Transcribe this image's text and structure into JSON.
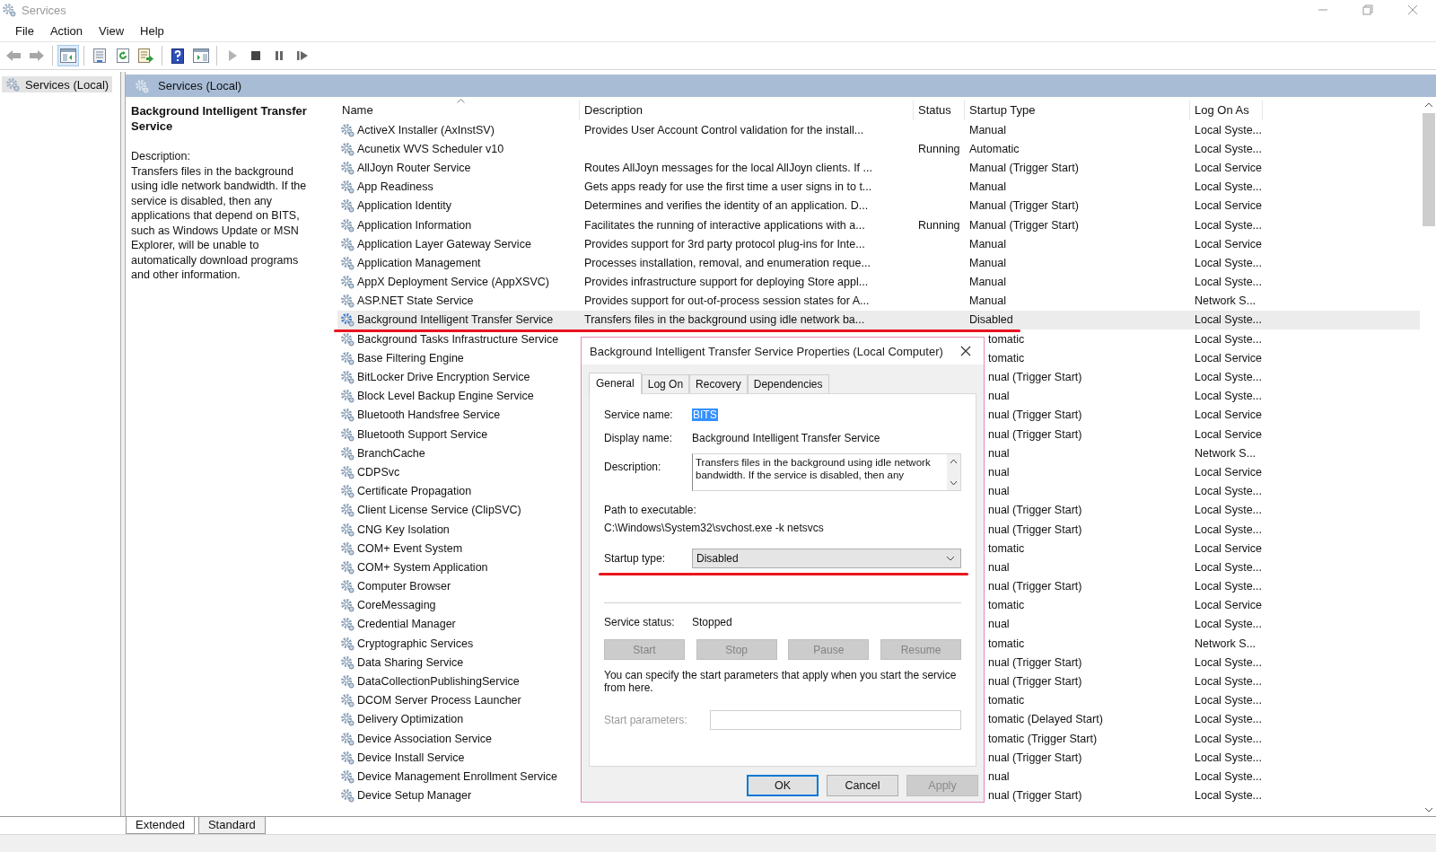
{
  "window": {
    "title": "Services"
  },
  "menu": [
    "File",
    "Action",
    "View",
    "Help"
  ],
  "toolbar": [
    {
      "kind": "back",
      "selected": false,
      "disabled": true
    },
    {
      "kind": "forward",
      "selected": false,
      "disabled": true
    },
    {
      "kind": "tree",
      "selected": true,
      "disabled": false
    },
    {
      "kind": "properties",
      "selected": false,
      "disabled": false
    },
    {
      "kind": "refresh",
      "selected": false,
      "disabled": false
    },
    {
      "kind": "export",
      "selected": false,
      "disabled": false
    },
    {
      "kind": "help",
      "selected": false,
      "disabled": false
    },
    {
      "kind": "pane",
      "selected": false,
      "disabled": false
    },
    {
      "kind": "play",
      "selected": false,
      "disabled": true
    },
    {
      "kind": "stop",
      "selected": false,
      "disabled": false
    },
    {
      "kind": "pause",
      "selected": false,
      "disabled": false
    },
    {
      "kind": "resume",
      "selected": false,
      "disabled": false
    }
  ],
  "tree": [
    {
      "label": "Services (Local)",
      "selected": true
    }
  ],
  "pane_header": "Services (Local)",
  "details": {
    "title": "Background Intelligent Transfer Service",
    "label": "Description:",
    "text": "Transfers files in the background using idle network bandwidth. If the service is disabled, then any applications that depend on BITS, such as Windows Update or MSN Explorer, will be unable to automatically download programs and other information."
  },
  "table": {
    "columns": [
      "Name",
      "Description",
      "Status",
      "Startup Type",
      "Log On As"
    ],
    "rows": [
      {
        "kind": "full",
        "name": "ActiveX Installer (AxInstSV)",
        "description": "Provides User Account Control validation for the install...",
        "status": "",
        "startup": "Manual",
        "logon": "Local Syste...",
        "selected": false,
        "marked": false
      },
      {
        "kind": "full",
        "name": "Acunetix WVS Scheduler v10",
        "description": "",
        "status": "Running",
        "startup": "Automatic",
        "logon": "Local Syste...",
        "selected": false,
        "marked": false
      },
      {
        "kind": "full",
        "name": "AllJoyn Router Service",
        "description": "Routes AllJoyn messages for the local AllJoyn clients. If ...",
        "status": "",
        "startup": "Manual (Trigger Start)",
        "logon": "Local Service",
        "selected": false,
        "marked": false
      },
      {
        "kind": "full",
        "name": "App Readiness",
        "description": "Gets apps ready for use the first time a user signs in to t...",
        "status": "",
        "startup": "Manual",
        "logon": "Local Syste...",
        "selected": false,
        "marked": false
      },
      {
        "kind": "full",
        "name": "Application Identity",
        "description": "Determines and verifies the identity of an application. D...",
        "status": "",
        "startup": "Manual (Trigger Start)",
        "logon": "Local Service",
        "selected": false,
        "marked": false
      },
      {
        "kind": "full",
        "name": "Application Information",
        "description": "Facilitates the running of interactive applications with a...",
        "status": "Running",
        "startup": "Manual (Trigger Start)",
        "logon": "Local Syste...",
        "selected": false,
        "marked": false
      },
      {
        "kind": "full",
        "name": "Application Layer Gateway Service",
        "description": "Provides support for 3rd party protocol plug-ins for Inte...",
        "status": "",
        "startup": "Manual",
        "logon": "Local Service",
        "selected": false,
        "marked": false
      },
      {
        "kind": "full",
        "name": "Application Management",
        "description": "Processes installation, removal, and enumeration reque...",
        "status": "",
        "startup": "Manual",
        "logon": "Local Syste...",
        "selected": false,
        "marked": false
      },
      {
        "kind": "full",
        "name": "AppX Deployment Service (AppXSVC)",
        "description": "Provides infrastructure support for deploying Store appl...",
        "status": "",
        "startup": "Manual",
        "logon": "Local Syste...",
        "selected": false,
        "marked": false
      },
      {
        "kind": "full",
        "name": "ASP.NET State Service",
        "description": "Provides support for out-of-process session states for A...",
        "status": "",
        "startup": "Manual",
        "logon": "Network S...",
        "selected": false,
        "marked": false
      },
      {
        "kind": "full",
        "name": "Background Intelligent Transfer Service",
        "description": "Transfers files in the background using idle network ba...",
        "status": "",
        "startup": "Disabled",
        "logon": "Local Syste...",
        "selected": true,
        "marked": true
      },
      {
        "kind": "partial",
        "name": "Background Tasks Infrastructure Service",
        "startup": "tomatic",
        "logon": "Local Syste...",
        "selected": false,
        "marked": false
      },
      {
        "kind": "partial",
        "name": "Base Filtering Engine",
        "startup": "tomatic",
        "logon": "Local Service",
        "selected": false,
        "marked": false
      },
      {
        "kind": "partial",
        "name": "BitLocker Drive Encryption Service",
        "startup": "nual (Trigger Start)",
        "logon": "Local Syste...",
        "selected": false,
        "marked": false
      },
      {
        "kind": "partial",
        "name": "Block Level Backup Engine Service",
        "startup": "nual",
        "logon": "Local Syste...",
        "selected": false,
        "marked": false
      },
      {
        "kind": "partial",
        "name": "Bluetooth Handsfree Service",
        "startup": "nual (Trigger Start)",
        "logon": "Local Service",
        "selected": false,
        "marked": false
      },
      {
        "kind": "partial",
        "name": "Bluetooth Support Service",
        "startup": "nual (Trigger Start)",
        "logon": "Local Service",
        "selected": false,
        "marked": false
      },
      {
        "kind": "partial",
        "name": "BranchCache",
        "startup": "nual",
        "logon": "Network S...",
        "selected": false,
        "marked": false
      },
      {
        "kind": "partial",
        "name": "CDPSvc",
        "startup": "nual",
        "logon": "Local Service",
        "selected": false,
        "marked": false
      },
      {
        "kind": "partial",
        "name": "Certificate Propagation",
        "startup": "nual",
        "logon": "Local Syste...",
        "selected": false,
        "marked": false
      },
      {
        "kind": "partial",
        "name": "Client License Service (ClipSVC)",
        "startup": "nual (Trigger Start)",
        "logon": "Local Syste...",
        "selected": false,
        "marked": false
      },
      {
        "kind": "partial",
        "name": "CNG Key Isolation",
        "startup": "nual (Trigger Start)",
        "logon": "Local Syste...",
        "selected": false,
        "marked": false
      },
      {
        "kind": "partial",
        "name": "COM+ Event System",
        "startup": "tomatic",
        "logon": "Local Service",
        "selected": false,
        "marked": false
      },
      {
        "kind": "partial",
        "name": "COM+ System Application",
        "startup": "nual",
        "logon": "Local Syste...",
        "selected": false,
        "marked": false
      },
      {
        "kind": "partial",
        "name": "Computer Browser",
        "startup": "nual (Trigger Start)",
        "logon": "Local Syste...",
        "selected": false,
        "marked": false
      },
      {
        "kind": "partial",
        "name": "CoreMessaging",
        "startup": "tomatic",
        "logon": "Local Service",
        "selected": false,
        "marked": false
      },
      {
        "kind": "partial",
        "name": "Credential Manager",
        "startup": "nual",
        "logon": "Local Syste...",
        "selected": false,
        "marked": false
      },
      {
        "kind": "partial",
        "name": "Cryptographic Services",
        "startup": "tomatic",
        "logon": "Network S...",
        "selected": false,
        "marked": false
      },
      {
        "kind": "partial",
        "name": "Data Sharing Service",
        "startup": "nual (Trigger Start)",
        "logon": "Local Syste...",
        "selected": false,
        "marked": false
      },
      {
        "kind": "partial",
        "name": "DataCollectionPublishingService",
        "startup": "nual (Trigger Start)",
        "logon": "Local Syste...",
        "selected": false,
        "marked": false
      },
      {
        "kind": "partial",
        "name": "DCOM Server Process Launcher",
        "startup": "tomatic",
        "logon": "Local Syste...",
        "selected": false,
        "marked": false
      },
      {
        "kind": "partial",
        "name": "Delivery Optimization",
        "startup": "tomatic (Delayed Start)",
        "logon": "Local Syste...",
        "selected": false,
        "marked": false
      },
      {
        "kind": "partial",
        "name": "Device Association Service",
        "startup": "tomatic (Trigger Start)",
        "logon": "Local Syste...",
        "selected": false,
        "marked": false
      },
      {
        "kind": "partial",
        "name": "Device Install Service",
        "startup": "nual (Trigger Start)",
        "logon": "Local Syste...",
        "selected": false,
        "marked": false
      },
      {
        "kind": "partial",
        "name": "Device Management Enrollment Service",
        "startup": "nual",
        "logon": "Local Syste...",
        "selected": false,
        "marked": false
      },
      {
        "kind": "partial",
        "name": "Device Setup Manager",
        "startup": "nual (Trigger Start)",
        "logon": "Local Syste...",
        "selected": false,
        "marked": false
      }
    ]
  },
  "view_tabs": [
    {
      "label": "Extended",
      "selected": true
    },
    {
      "label": "Standard",
      "selected": false
    }
  ],
  "dialog": {
    "title": "Background Intelligent Transfer Service Properties (Local Computer)",
    "tabs": [
      {
        "label": "General",
        "selected": true
      },
      {
        "label": "Log On",
        "selected": false
      },
      {
        "label": "Recovery",
        "selected": false
      },
      {
        "label": "Dependencies",
        "selected": false
      }
    ],
    "service_name_label": "Service name:",
    "service_name": "BITS",
    "display_name_label": "Display name:",
    "display_name": "Background Intelligent Transfer Service",
    "description_label": "Description:",
    "description": "Transfers files in the background using idle network bandwidth. If the service is disabled, then any",
    "path_label": "Path to executable:",
    "path": "C:\\Windows\\System32\\svchost.exe -k netsvcs",
    "startup_label": "Startup type:",
    "startup_value": "Disabled",
    "startup_marked": true,
    "status_label": "Service status:",
    "status": "Stopped",
    "control_buttons": [
      {
        "label": "Start",
        "disabled": true
      },
      {
        "label": "Stop",
        "disabled": true
      },
      {
        "label": "Pause",
        "disabled": true
      },
      {
        "label": "Resume",
        "disabled": true
      }
    ],
    "hint": "You can specify the start parameters that apply when you start the service from here.",
    "params_label": "Start parameters:",
    "buttons": [
      {
        "label": "OK",
        "disabled": false
      },
      {
        "label": "Cancel",
        "disabled": false
      },
      {
        "label": "Apply",
        "disabled": true
      }
    ]
  }
}
